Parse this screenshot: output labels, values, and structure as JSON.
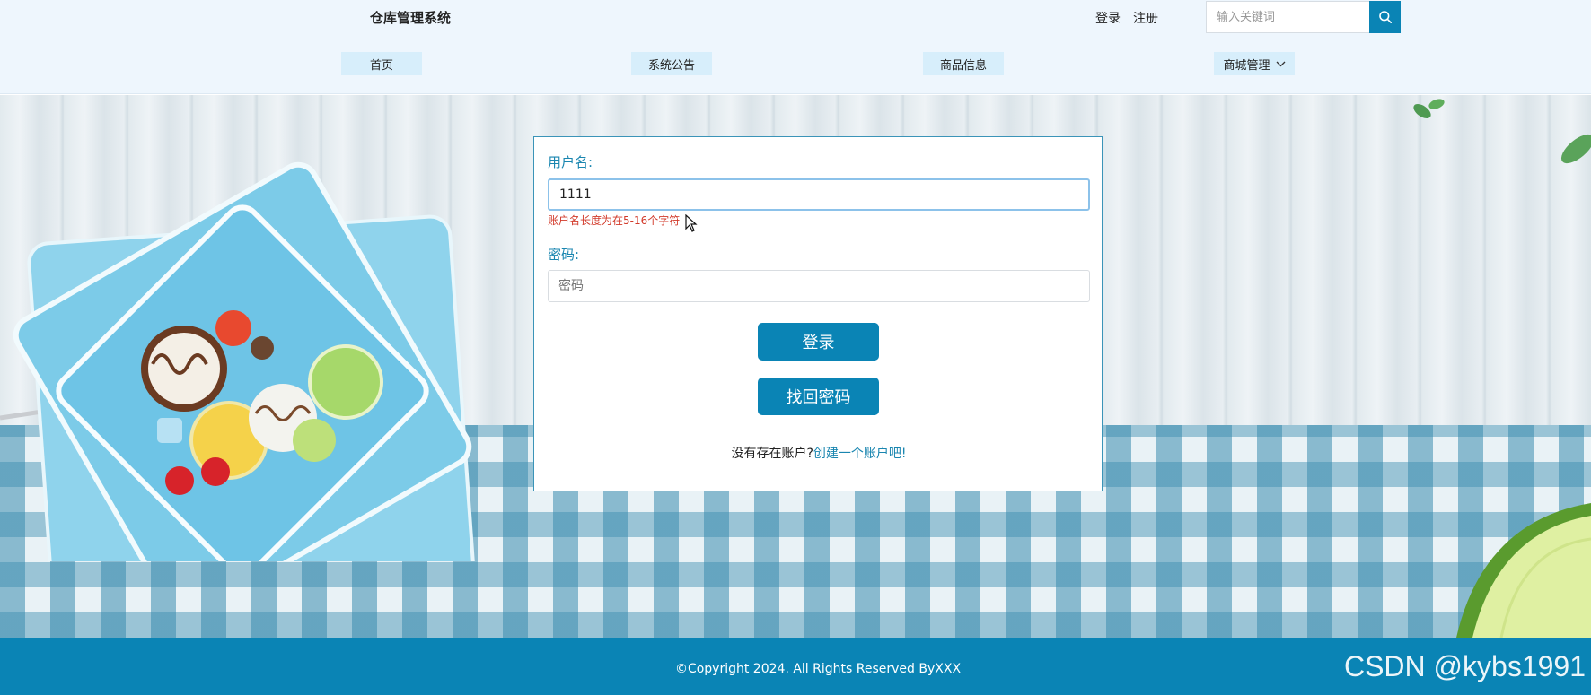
{
  "header": {
    "brand": "仓库管理系统",
    "login_link": "登录",
    "register_link": "注册",
    "search": {
      "placeholder": "输入关键词",
      "icon": "search-icon"
    },
    "nav": {
      "home": "首页",
      "notice": "系统公告",
      "goods": "商品信息",
      "mall": "商城管理",
      "mall_icon": "chevron-down-icon"
    }
  },
  "login_form": {
    "username_label": "用户名:",
    "username_value": "1111",
    "username_error": "账户名长度为在5-16个字符",
    "password_label": "密码:",
    "password_placeholder": "密码",
    "login_button": "登录",
    "find_password_button": "找回密码",
    "no_account_text": "没有存在账户?",
    "create_account_link": "创建一个账户吧!"
  },
  "footer": {
    "copyright": "©Copyright 2024. All Rights Reserved ByXXX",
    "watermark": "CSDN @kybs1991"
  },
  "colors": {
    "accent": "#0a84b5",
    "header_bg": "#eef6fd",
    "error": "#d23a2a"
  }
}
